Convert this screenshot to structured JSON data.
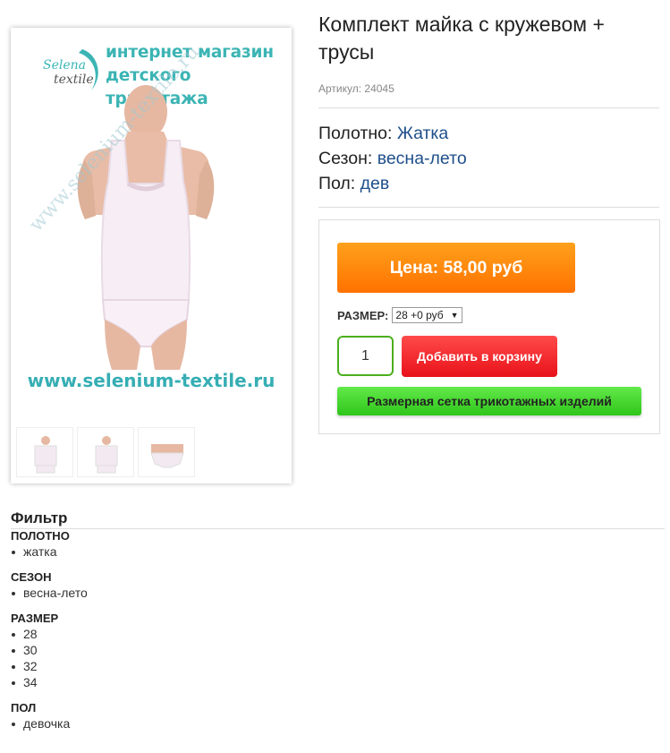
{
  "gallery": {
    "logo_line1": "Selena",
    "logo_line2": "textile",
    "shop_line1": "интернет магазин",
    "shop_line2": "детского трикотажа",
    "watermark": "www.selenium-textile.ru",
    "site_url": "www.selenium-textile.ru",
    "thumbnail_count": 3
  },
  "product": {
    "title": "Комплект майка с кружевом + трусы",
    "sku": "Артикул: 24045",
    "attributes": [
      {
        "label": "Полотно:",
        "value": "Жатка"
      },
      {
        "label": "Сезон:",
        "value": "весна-лето"
      },
      {
        "label": "Пол:",
        "value": "дев"
      }
    ]
  },
  "buy": {
    "price_label": "Цена: 58,00 руб",
    "size_label": "РАЗМЕР:",
    "size_selected": "28 +0 руб",
    "quantity": "1",
    "add_to_cart": "Добавить в корзину",
    "size_chart": "Размерная сетка трикотажных изделий",
    "colors": {
      "price": "#ff8a0c",
      "cart": "#f0282d",
      "size_chart": "#45d62e",
      "qty_border": "#4caf1e"
    }
  },
  "filter": {
    "title": "Фильтр",
    "groups": [
      {
        "name": "ПОЛОТНО",
        "items": [
          "жатка"
        ]
      },
      {
        "name": "СЕЗОН",
        "items": [
          "весна-лето"
        ]
      },
      {
        "name": "РАЗМЕР",
        "items": [
          "28",
          "30",
          "32",
          "34"
        ]
      },
      {
        "name": "ПОЛ",
        "items": [
          "девочка"
        ]
      }
    ]
  }
}
